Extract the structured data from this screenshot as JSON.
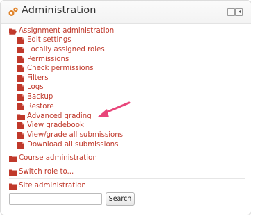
{
  "block": {
    "title": "Administration",
    "icons": {
      "header": "gears-icon",
      "dock": "dock-icon",
      "collapse": "collapse-icon"
    }
  },
  "assignment_admin": {
    "label": "Assignment administration",
    "icon": "folder-open-icon",
    "items": [
      {
        "label": "Edit settings",
        "icon": "file-icon"
      },
      {
        "label": "Locally assigned roles",
        "icon": "file-icon"
      },
      {
        "label": "Permissions",
        "icon": "file-icon"
      },
      {
        "label": "Check permissions",
        "icon": "file-icon"
      },
      {
        "label": "Filters",
        "icon": "file-icon"
      },
      {
        "label": "Logs",
        "icon": "file-icon"
      },
      {
        "label": "Backup",
        "icon": "file-icon"
      },
      {
        "label": "Restore",
        "icon": "file-icon"
      },
      {
        "label": "Advanced grading",
        "icon": "folder-icon"
      },
      {
        "label": "View gradebook",
        "icon": "file-icon"
      },
      {
        "label": "View/grade all submissions",
        "icon": "file-icon"
      },
      {
        "label": "Download all submissions",
        "icon": "file-icon"
      }
    ]
  },
  "sections": [
    {
      "label": "Course administration",
      "icon": "folder-icon"
    },
    {
      "label": "Switch role to...",
      "icon": "folder-icon"
    },
    {
      "label": "Site administration",
      "icon": "folder-icon"
    }
  ],
  "search": {
    "value": "",
    "button_label": "Search"
  },
  "annotation": {
    "color": "#e8457a"
  },
  "colors": {
    "link": "#c0392b",
    "icon_red": "#c0392b",
    "header_icon": "#e0832a"
  }
}
